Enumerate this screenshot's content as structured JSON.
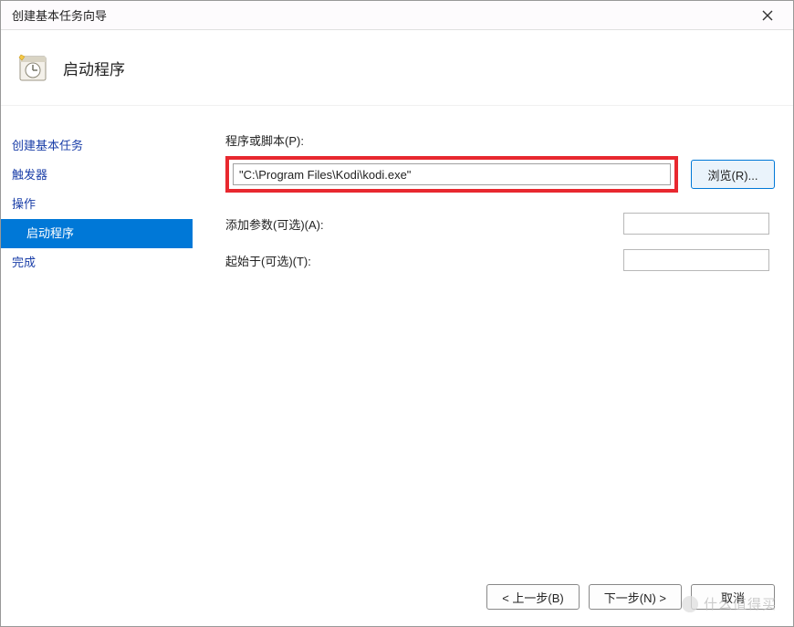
{
  "window": {
    "title": "创建基本任务向导"
  },
  "header": {
    "page_title": "启动程序"
  },
  "sidebar": {
    "items": [
      {
        "label": "创建基本任务",
        "indent": false,
        "selected": false
      },
      {
        "label": "触发器",
        "indent": false,
        "selected": false
      },
      {
        "label": "操作",
        "indent": false,
        "selected": false
      },
      {
        "label": "启动程序",
        "indent": true,
        "selected": true
      },
      {
        "label": "完成",
        "indent": false,
        "selected": false
      }
    ]
  },
  "main": {
    "program_label": "程序或脚本(P):",
    "program_value": "\"C:\\Program Files\\Kodi\\kodi.exe\"",
    "browse_label": "浏览(R)...",
    "args_label": "添加参数(可选)(A):",
    "args_value": "",
    "startin_label": "起始于(可选)(T):",
    "startin_value": ""
  },
  "footer": {
    "back_label": "< 上一步(B)",
    "next_label": "下一步(N) >",
    "cancel_label": "取消"
  },
  "watermark": {
    "text": "什么值得买"
  }
}
